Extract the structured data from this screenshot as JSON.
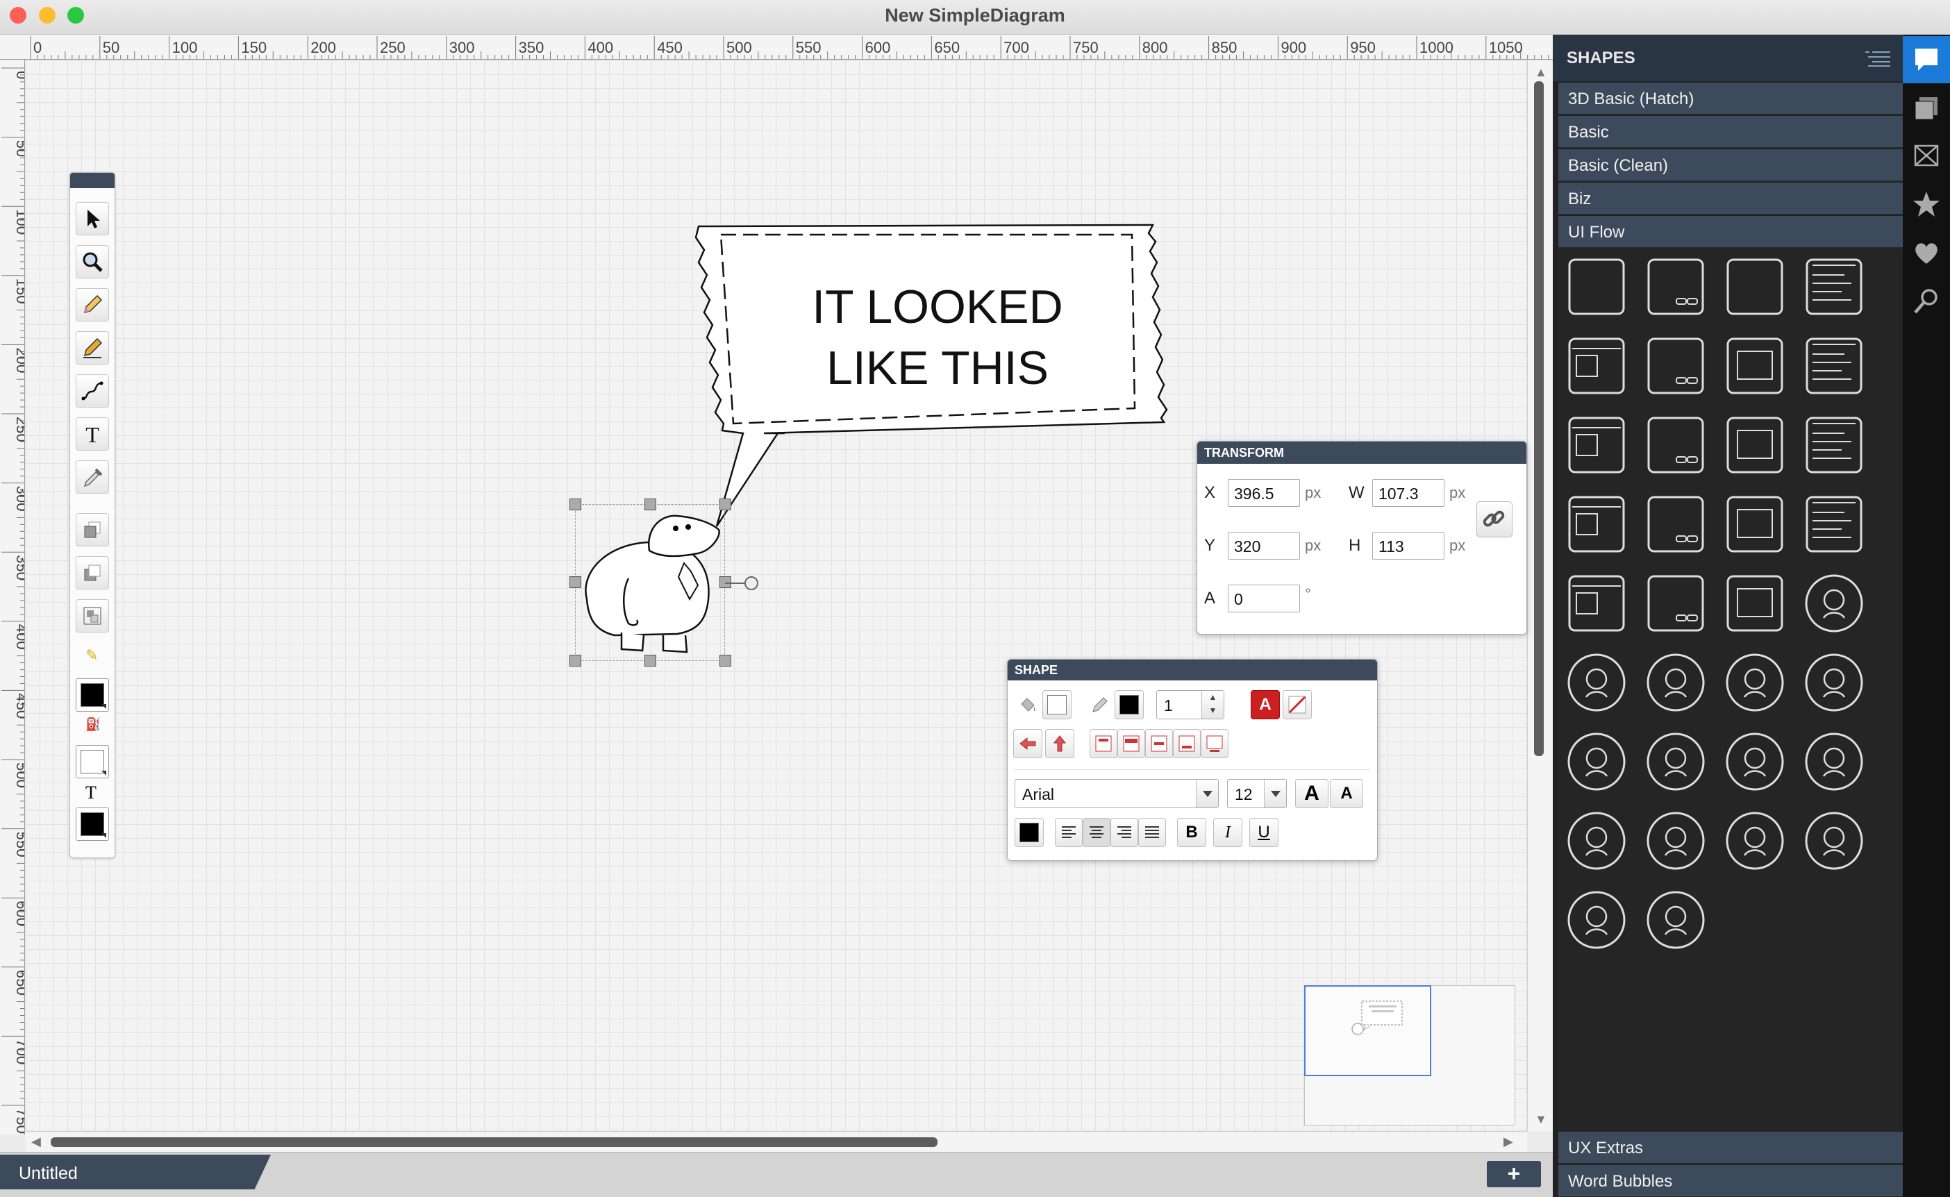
{
  "window": {
    "title": "New SimpleDiagram"
  },
  "ruler": {
    "h_labels": [
      "0",
      "50",
      "100",
      "150",
      "200",
      "250",
      "300",
      "350",
      "400",
      "450",
      "500",
      "550",
      "600",
      "650",
      "700",
      "750",
      "800",
      "850",
      "900",
      "950",
      "1000",
      "1050"
    ],
    "v_labels": [
      "0",
      "50",
      "100",
      "150",
      "200",
      "250",
      "300",
      "350",
      "400",
      "450",
      "500",
      "550",
      "600",
      "650",
      "700",
      "750"
    ]
  },
  "canvas": {
    "bubble_text_line1": "IT LOOKED",
    "bubble_text_line2": "LIKE THIS"
  },
  "transform_panel": {
    "title": "TRANSFORM",
    "x_label": "X",
    "x_value": "396.5",
    "x_unit": "px",
    "w_label": "W",
    "w_value": "107.3",
    "w_unit": "px",
    "y_label": "Y",
    "y_value": "320",
    "y_unit": "px",
    "h_label": "H",
    "h_value": "113",
    "h_unit": "px",
    "a_label": "A",
    "a_value": "0",
    "a_unit": "°"
  },
  "shape_panel": {
    "title": "SHAPE",
    "stroke_width": "1",
    "font_family": "Arial",
    "font_size": "12",
    "bold_label": "B",
    "italic_label": "I",
    "underline_label": "U",
    "text_color_label": "A"
  },
  "tabs": {
    "document": "Untitled",
    "add_label": "+"
  },
  "sidebar": {
    "title": "SHAPES",
    "categories_top": [
      "3D Basic (Hatch)",
      "Basic",
      "Basic (Clean)",
      "Biz",
      "UI Flow"
    ],
    "categories_bottom": [
      "UX Extras",
      "Word Bubbles"
    ]
  },
  "colors": {
    "accent": "#1c7bd9",
    "panel_header": "#3d4a5c",
    "sidebar_bg": "#222222"
  }
}
